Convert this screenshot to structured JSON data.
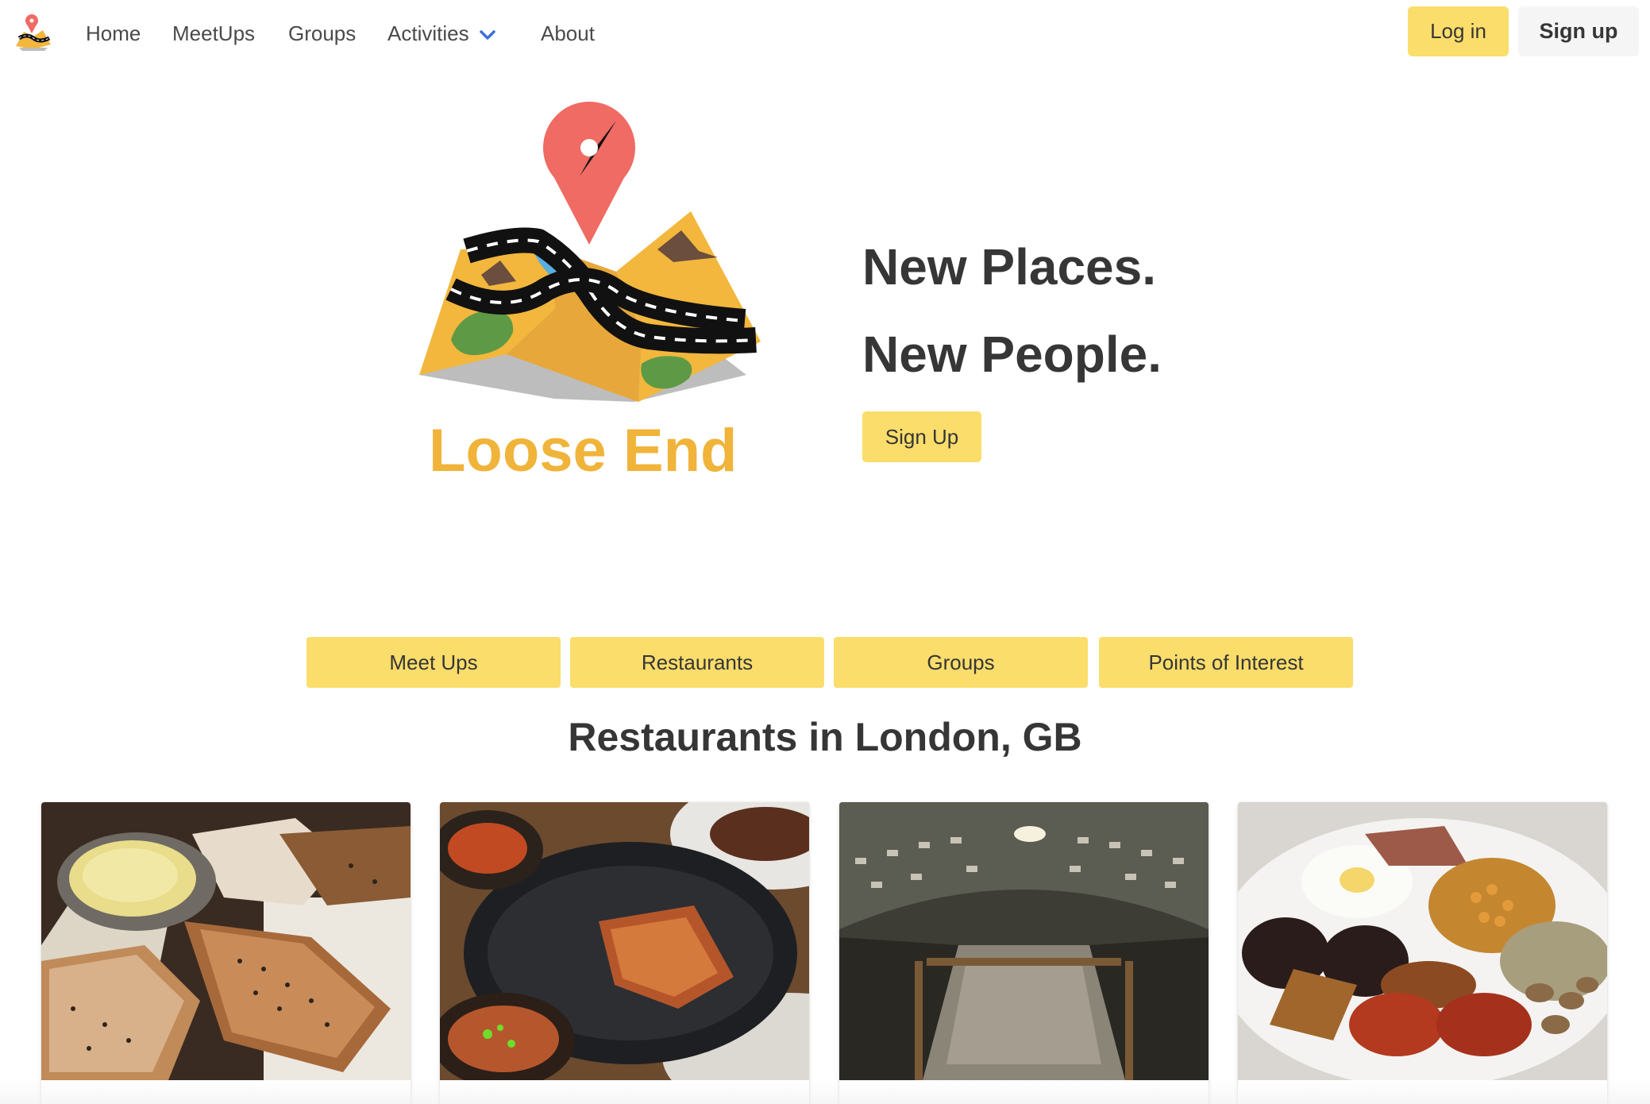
{
  "nav": {
    "logo_icon": "loose-end-map-logo-icon",
    "items": [
      {
        "label": "Home"
      },
      {
        "label": "MeetUps"
      },
      {
        "label": "Groups"
      },
      {
        "label": "Activities"
      },
      {
        "label": "About"
      }
    ],
    "activities_icon": "chevron-down-icon",
    "login_label": "Log in",
    "signup_label": "Sign up"
  },
  "hero": {
    "brand_name": "Loose End",
    "tagline_1": "New Places.",
    "tagline_2": "New People.",
    "signup_label": "Sign Up"
  },
  "categories": [
    {
      "label": "Meet Ups"
    },
    {
      "label": "Restaurants"
    },
    {
      "label": "Groups"
    },
    {
      "label": "Points of Interest"
    }
  ],
  "section_title": "Restaurants in London, GB",
  "cards": [
    {
      "image_subject": "bread-and-butter-photo"
    },
    {
      "image_subject": "grilled-dishes-skillet-photo"
    },
    {
      "image_subject": "wine-cellar-dining-room-photo"
    },
    {
      "image_subject": "full-english-breakfast-photo"
    }
  ],
  "colors": {
    "accent_yellow": "#fadd6b",
    "brand_orange": "#f0b43a",
    "pin_red": "#ef6b63",
    "chevron_blue": "#3e6fd8",
    "text_dark": "#363636"
  }
}
